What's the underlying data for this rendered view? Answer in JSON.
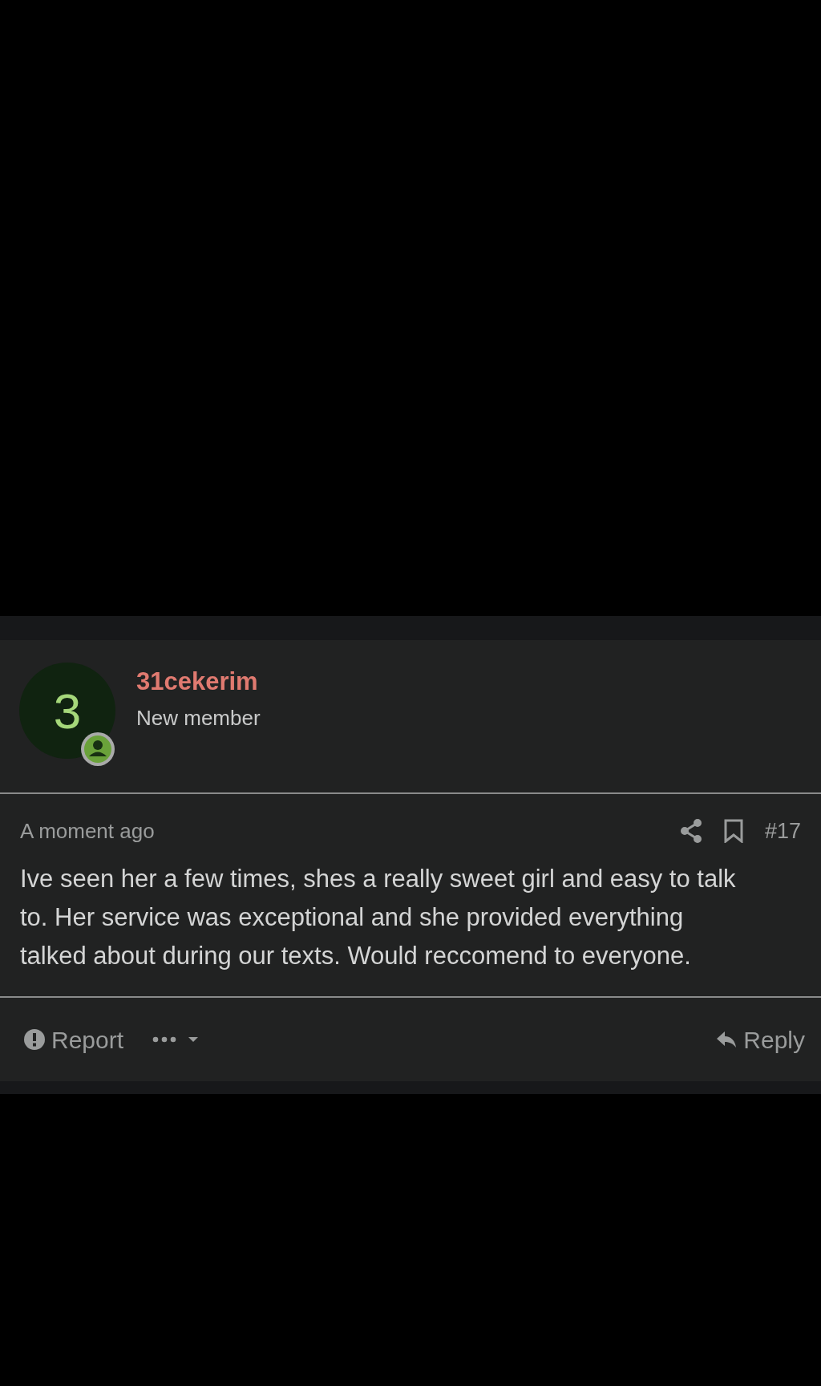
{
  "post": {
    "author": {
      "avatar_letter": "3",
      "username": "31cekerim",
      "role": "New member"
    },
    "time": "A moment ago",
    "post_number": "#17",
    "body": "Ive seen her a few times, shes a really sweet girl and easy to talk to. Her service was exceptional and she provided everything talked about during our texts. Would reccomend to everyone.",
    "actions": {
      "report": "Report",
      "reply": "Reply"
    }
  }
}
